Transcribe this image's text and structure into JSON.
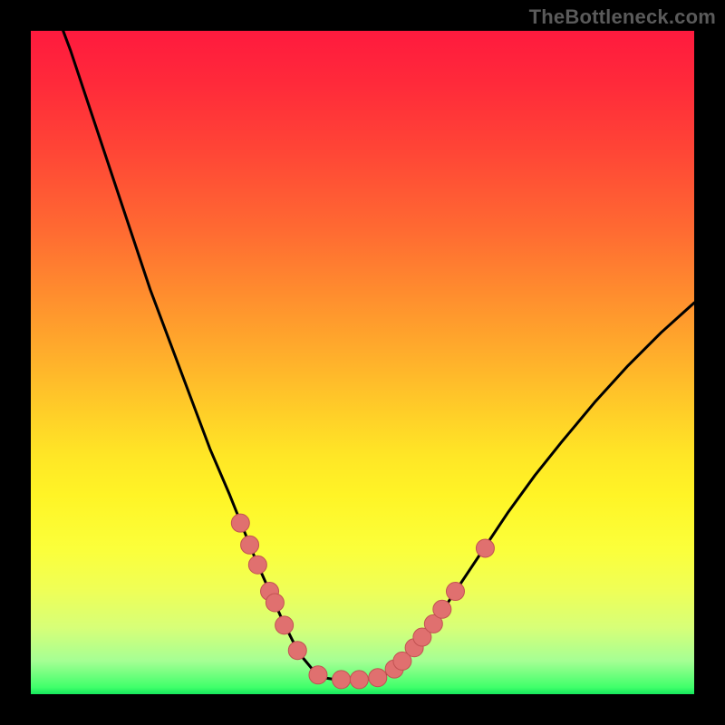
{
  "watermark": "TheBottleneck.com",
  "colors": {
    "frame": "#000000",
    "curve": "#000000",
    "marker_fill": "#e0706f",
    "marker_stroke": "#c25252"
  },
  "chart_data": {
    "type": "line",
    "title": "",
    "xlabel": "",
    "ylabel": "",
    "xlim": [
      0,
      100
    ],
    "ylim": [
      0,
      100
    ],
    "x": [
      3,
      6,
      9,
      12,
      15,
      18,
      21,
      24,
      27,
      30,
      32,
      34,
      36,
      38,
      39.5,
      41,
      42.5,
      44,
      46,
      48,
      50,
      52,
      54,
      56,
      58,
      61,
      64,
      68,
      72,
      76,
      80,
      85,
      90,
      95,
      100
    ],
    "values": [
      105,
      97,
      88,
      79,
      70,
      61,
      53,
      45,
      37,
      30,
      25,
      20,
      15.5,
      11,
      8,
      5.5,
      3.7,
      2.5,
      2.2,
      2.2,
      2.2,
      2.4,
      3.2,
      5,
      7.5,
      11,
      15.5,
      21.5,
      27.5,
      33,
      38,
      44,
      49.5,
      54.5,
      59
    ],
    "markers": [
      {
        "x": 31.6,
        "y": 25.8
      },
      {
        "x": 33.0,
        "y": 22.5
      },
      {
        "x": 34.2,
        "y": 19.5
      },
      {
        "x": 36.0,
        "y": 15.5
      },
      {
        "x": 36.8,
        "y": 13.8
      },
      {
        "x": 38.2,
        "y": 10.4
      },
      {
        "x": 40.2,
        "y": 6.6
      },
      {
        "x": 43.3,
        "y": 2.9
      },
      {
        "x": 46.8,
        "y": 2.2
      },
      {
        "x": 49.5,
        "y": 2.2
      },
      {
        "x": 52.3,
        "y": 2.5
      },
      {
        "x": 54.8,
        "y": 3.8
      },
      {
        "x": 56.0,
        "y": 5.0
      },
      {
        "x": 57.8,
        "y": 7.0
      },
      {
        "x": 59.0,
        "y": 8.6
      },
      {
        "x": 60.7,
        "y": 10.6
      },
      {
        "x": 62.0,
        "y": 12.8
      },
      {
        "x": 64.0,
        "y": 15.5
      },
      {
        "x": 68.5,
        "y": 22.0
      }
    ]
  }
}
